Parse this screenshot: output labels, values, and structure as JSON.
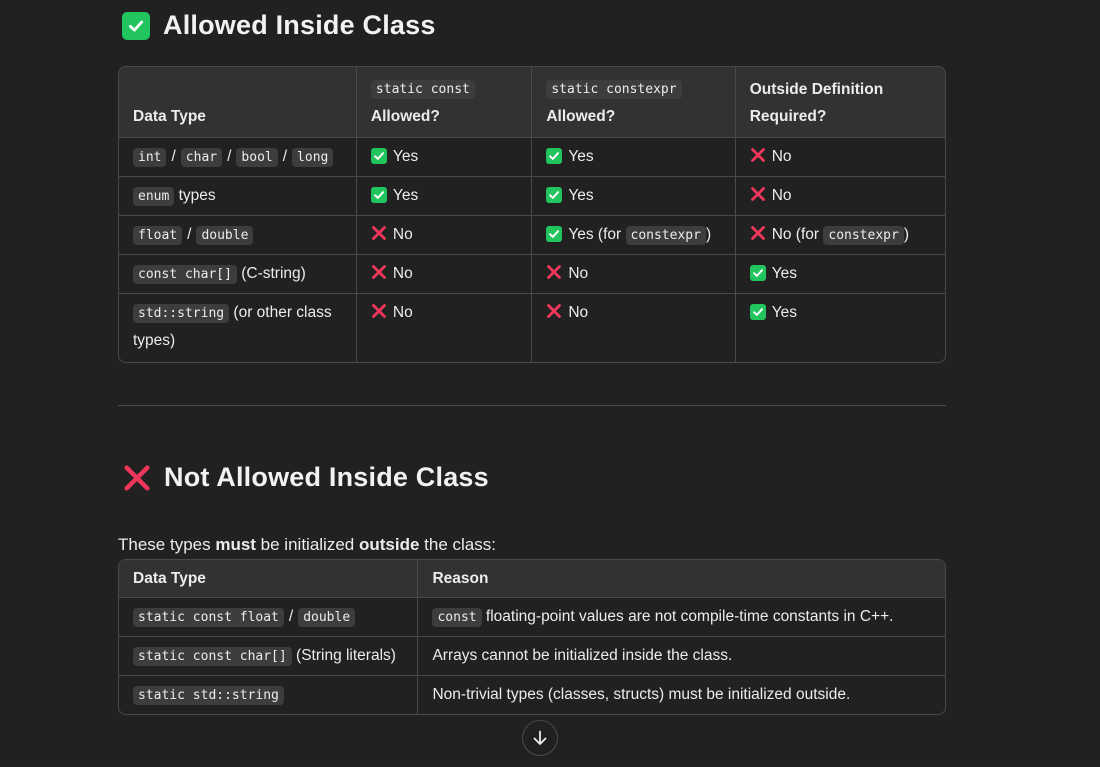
{
  "section1": {
    "title": "Allowed Inside Class",
    "icon": "check-mark-button-icon"
  },
  "table1": {
    "headers": {
      "data_type": "Data Type",
      "col2_code": "static const",
      "col2_label": "Allowed?",
      "col3_code": "static constexpr",
      "col3_label": "Allowed?",
      "col4_line1": "Outside Definition",
      "col4_line2": "Required?"
    },
    "rows": [
      {
        "types": [
          "int",
          "char",
          "bool",
          "long"
        ],
        "sep": "/",
        "c2": "Yes",
        "c3": "Yes",
        "c4": "No"
      },
      {
        "code": "enum",
        "text": "types",
        "c2": "Yes",
        "c3": "Yes",
        "c4": "No"
      },
      {
        "types": [
          "float",
          "double"
        ],
        "sep": "/",
        "c2": "No",
        "c3": "Yes (for",
        "c3_code": "constexpr",
        "c3_end": ")",
        "c4": "No (for",
        "c4_code": "constexpr",
        "c4_end": ")"
      },
      {
        "code": "const char[]",
        "text": "(C-string)",
        "c2": "No",
        "c3": "No",
        "c4": "Yes"
      },
      {
        "code": "std::string",
        "text": "(or other class",
        "text2": "types)",
        "c2": "No",
        "c3": "No",
        "c4": "Yes"
      }
    ]
  },
  "section2": {
    "title": "Not Allowed Inside Class",
    "icon": "cross-mark-icon",
    "intro_a": "These types ",
    "intro_b": "must",
    "intro_c": " be initialized ",
    "intro_d": "outside",
    "intro_e": " the class:"
  },
  "table2": {
    "headers": {
      "data_type": "Data Type",
      "reason": "Reason"
    },
    "rows": [
      {
        "code": "static const float",
        "sep": "/",
        "code2": "double",
        "reason_code": "const",
        "reason": "floating-point values are not compile-time constants in C++."
      },
      {
        "code": "static const char[]",
        "text": "(String literals)",
        "reason": "Arrays cannot be initialized inside the class."
      },
      {
        "code": "static std::string",
        "reason": "Non-trivial types (classes, structs) must be initialized outside."
      }
    ]
  },
  "colors": {
    "background": "#212121",
    "check_green": "#21c45d",
    "cross_red": "#f0365a"
  },
  "scroll_button": {
    "icon": "arrow-down-icon"
  }
}
